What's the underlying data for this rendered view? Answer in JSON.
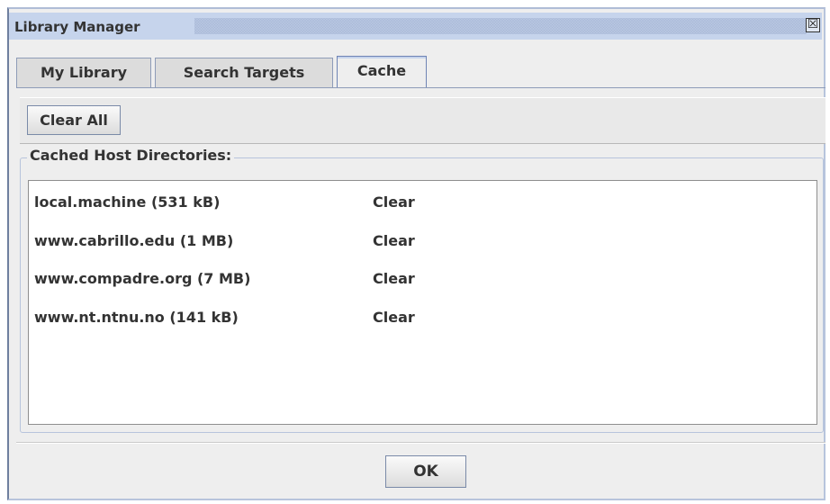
{
  "window": {
    "title": "Library Manager",
    "close_label": "☒"
  },
  "tabs": [
    {
      "label": "My Library",
      "selected": false
    },
    {
      "label": "Search Targets",
      "selected": false
    },
    {
      "label": "Cache",
      "selected": true
    }
  ],
  "toolbar": {
    "clear_all_label": "Clear All"
  },
  "cache": {
    "group_title": "Cached Host Directories:",
    "entries": [
      {
        "host": "local.machine (531 kB)",
        "action": "Clear"
      },
      {
        "host": "www.cabrillo.edu (1 MB)",
        "action": "Clear"
      },
      {
        "host": "www.compadre.org (7 MB)",
        "action": "Clear"
      },
      {
        "host": "www.nt.ntnu.no (141 kB)",
        "action": "Clear"
      }
    ]
  },
  "footer": {
    "ok_label": "OK"
  },
  "colors": {
    "titlebar": "#c6d4ec",
    "panel": "#eeeeee",
    "border_accent": "#6f84b5"
  }
}
